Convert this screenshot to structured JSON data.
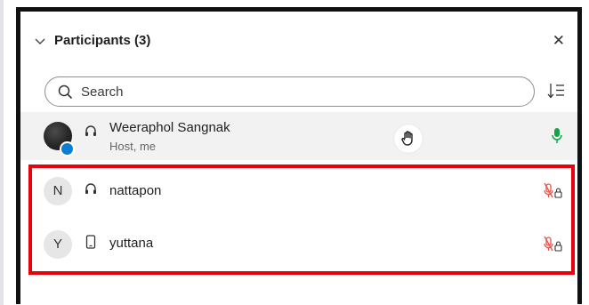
{
  "header": {
    "title": "Participants (3)"
  },
  "search": {
    "placeholder": "Search"
  },
  "participants": [
    {
      "name": "Weeraphol Sangnak",
      "role": "Host, me",
      "device": "headset-icon",
      "mic": "on"
    },
    {
      "name": "nattapon",
      "initial": "N",
      "device": "headset-icon",
      "mic": "muted-locked"
    },
    {
      "name": "yuttana",
      "initial": "Y",
      "device": "phone-icon",
      "mic": "muted-locked"
    }
  ],
  "colors": {
    "mic_on": "#15a34a",
    "mic_off": "#e0544b",
    "highlight": "#e8000b"
  }
}
